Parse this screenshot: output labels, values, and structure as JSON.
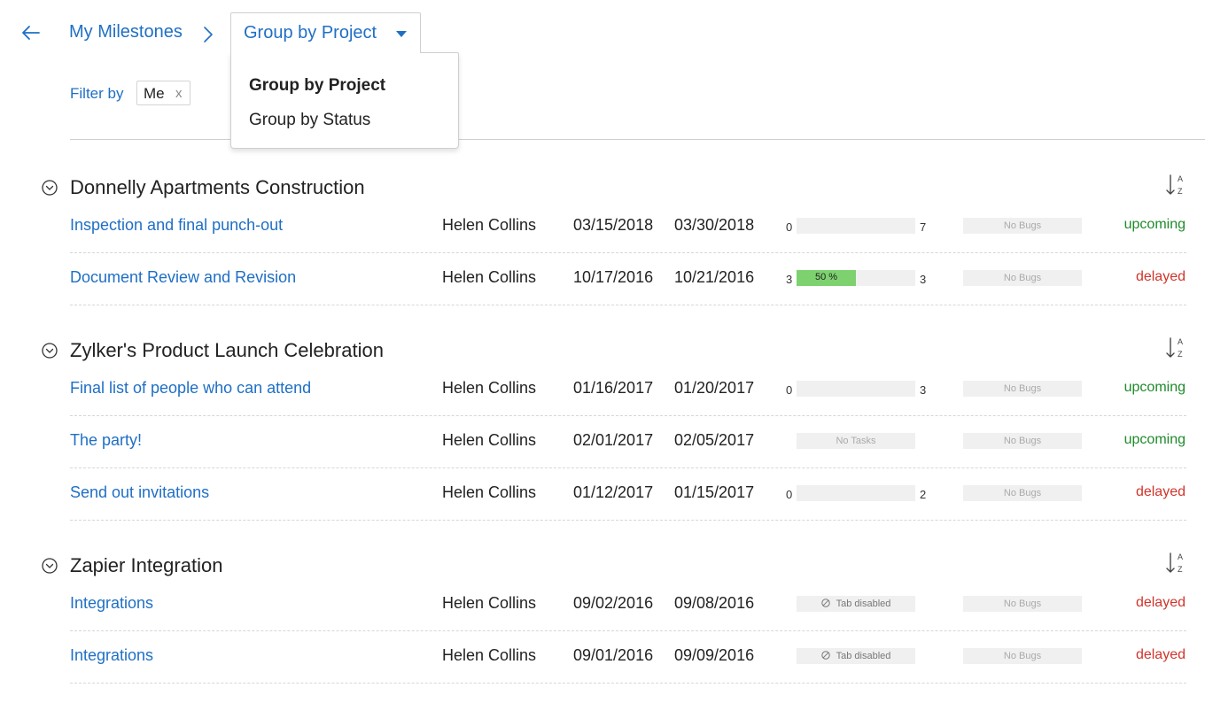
{
  "header": {
    "breadcrumb": "My Milestones",
    "group_label": "Group by Project"
  },
  "dropdown": {
    "options": [
      "Group by Project",
      "Group by Status"
    ]
  },
  "filter": {
    "label": "Filter by",
    "chip": "Me",
    "chip_remove": "x"
  },
  "colors": {
    "link": "#1f6fc5",
    "upcoming": "#1e8a2a",
    "delayed": "#d0342c",
    "progress": "#7dd26f"
  },
  "groups": [
    {
      "title": "Donnelly Apartments Construction",
      "rows": [
        {
          "name": "Inspection and final punch-out",
          "owner": "Helen Collins",
          "start": "03/15/2018",
          "end": "03/30/2018",
          "tasks": {
            "kind": "progress",
            "left": "0",
            "right": "7",
            "label": "",
            "pct": 0
          },
          "bugs": "No Bugs",
          "status": "upcoming"
        },
        {
          "name": "Document Review and Revision",
          "owner": "Helen Collins",
          "start": "10/17/2016",
          "end": "10/21/2016",
          "tasks": {
            "kind": "progress",
            "left": "3",
            "right": "3",
            "label": "50 %",
            "pct": 50
          },
          "bugs": "No Bugs",
          "status": "delayed"
        }
      ]
    },
    {
      "title": "Zylker's Product Launch Celebration",
      "rows": [
        {
          "name": "Final list of people who can attend",
          "owner": "Helen Collins",
          "start": "01/16/2017",
          "end": "01/20/2017",
          "tasks": {
            "kind": "progress",
            "left": "0",
            "right": "3",
            "label": "",
            "pct": 0
          },
          "bugs": "No Bugs",
          "status": "upcoming"
        },
        {
          "name": "The party!",
          "owner": "Helen Collins",
          "start": "02/01/2017",
          "end": "02/05/2017",
          "tasks": {
            "kind": "text",
            "label": "No Tasks"
          },
          "bugs": "No Bugs",
          "status": "upcoming"
        },
        {
          "name": "Send out invitations",
          "owner": "Helen Collins",
          "start": "01/12/2017",
          "end": "01/15/2017",
          "tasks": {
            "kind": "progress",
            "left": "0",
            "right": "2",
            "label": "",
            "pct": 0
          },
          "bugs": "No Bugs",
          "status": "delayed"
        }
      ]
    },
    {
      "title": "Zapier Integration",
      "rows": [
        {
          "name": "Integrations",
          "owner": "Helen Collins",
          "start": "09/02/2016",
          "end": "09/08/2016",
          "tasks": {
            "kind": "disabled",
            "label": "Tab disabled"
          },
          "bugs": "No Bugs",
          "status": "delayed"
        },
        {
          "name": "Integrations",
          "owner": "Helen Collins",
          "start": "09/01/2016",
          "end": "09/09/2016",
          "tasks": {
            "kind": "disabled",
            "label": "Tab disabled"
          },
          "bugs": "No Bugs",
          "status": "delayed"
        }
      ]
    }
  ]
}
